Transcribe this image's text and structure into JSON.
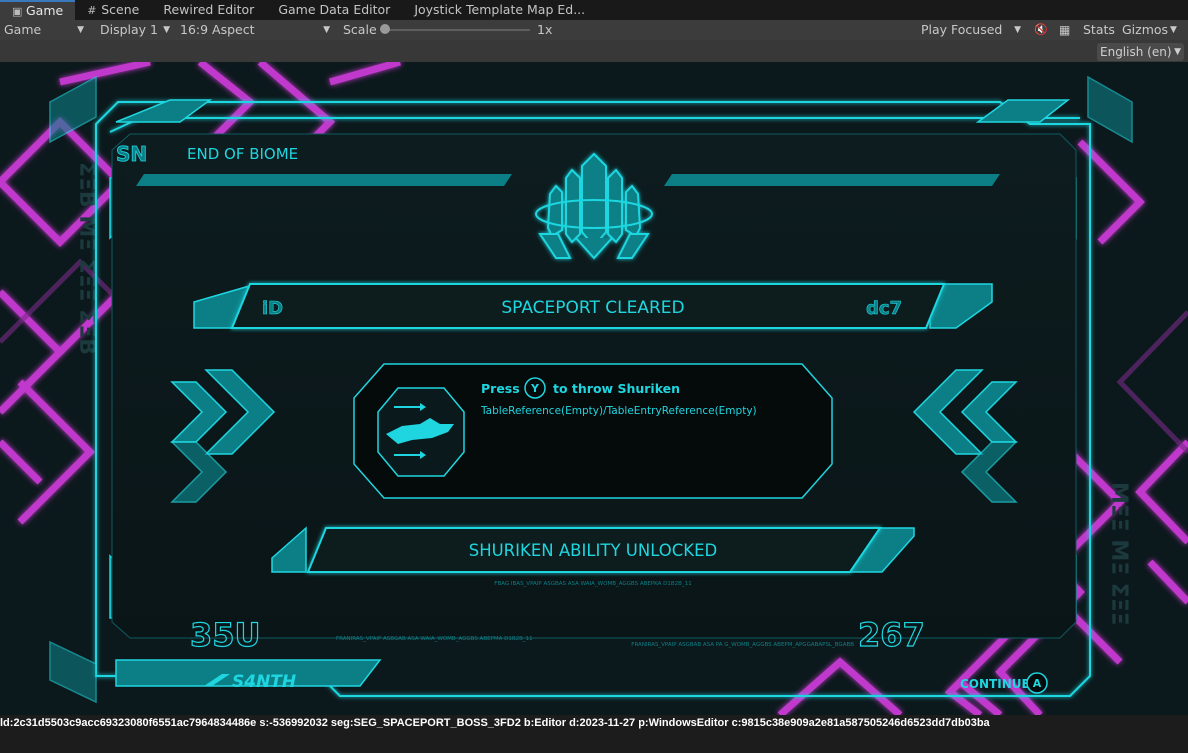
{
  "tabs": [
    {
      "label": "Game",
      "icon": "gamepad-icon",
      "active": true
    },
    {
      "label": "Scene",
      "icon": "grid-icon"
    },
    {
      "label": "Rewired Editor"
    },
    {
      "label": "Game Data Editor"
    },
    {
      "label": "Joystick Template Map Ed..."
    }
  ],
  "toolbar": {
    "view": "Game",
    "display": "Display 1",
    "aspect": "16:9 Aspect",
    "scale_label": "Scale",
    "scale_value": "1x",
    "play_mode": "Play Focused",
    "stats": "Stats",
    "gizmos": "Gizmos"
  },
  "language": "English (en)",
  "game": {
    "header_glyph": "SN",
    "biome_label": "END OF BIOME",
    "banner_title": "SPACEPORT CLEARED",
    "banner_glyph_left": "iD",
    "banner_glyph_right": "dc7",
    "press_label": "Press",
    "button_glyph": "Y",
    "throw_label": "to throw Shuriken",
    "table_ref": "TableReference(Empty)/TableEntryReference(Empty)",
    "unlock_label": "SHURIKEN ABILITY UNLOCKED",
    "micro_text": "FBAG IBAS_VPAIP ASGBAS ASA WAIA_WOMB_AGGBS ABEPKA D1B2B_11",
    "corner_glyph_left": "35U",
    "corner_glyph_right": "267",
    "micro_left": "FRANIRAS_VPAIP ASBGAB ASA WAIA_WOMB_AGGBS ABEPMA D1B2B_11",
    "micro_right": "FRANIRAS_VPAIP ASGBAB ASA PA G_WOMB_AGGBS ABEPM_APGGABAPSL_BGABB",
    "brand": "S4NTH",
    "continue_label": "CONTINUE",
    "continue_button": "A"
  },
  "status_line": "ld:2c31d5503c9acc69323080f6551ac7964834486e s:-536992032 seg:SEG_SPACEPORT_BOSS_3FD2 b:Editor d:2023-11-27 p:WindowsEditor c:9815c38e909a2e81a587505246d6523dd7db03ba",
  "colors": {
    "cyan": "#1fd6e0",
    "teal": "#0c7f86",
    "magenta": "#d53ee0",
    "editor_bg": "#3c3c3c"
  }
}
